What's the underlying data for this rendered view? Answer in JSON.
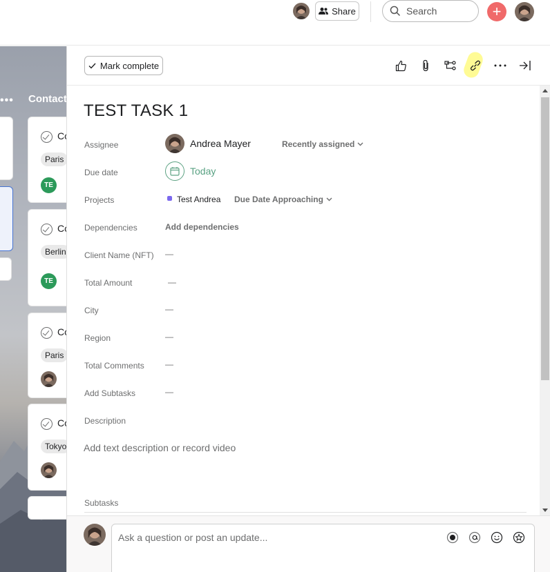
{
  "topbar": {
    "share_label": "Share",
    "search_placeholder": "Search",
    "create_label": "+"
  },
  "board": {
    "column_dots": "•••",
    "column_title": "Contacts",
    "cards": [
      {
        "title": "Co",
        "tag": "Paris",
        "assignee": "TE"
      },
      {
        "title": "Co",
        "tag": "Berlin",
        "assignee": "TE"
      },
      {
        "title": "Co",
        "tag": "Paris",
        "assignee": "avatar"
      },
      {
        "title": "Co",
        "tag": "Tokyo",
        "assignee": "avatar"
      }
    ]
  },
  "toolbar": {
    "mark_complete_label": "Mark complete",
    "icons": [
      "like-icon",
      "attachment-icon",
      "subtask-icon",
      "link-icon",
      "more-icon",
      "close-pane-icon"
    ]
  },
  "task": {
    "title": "TEST TASK 1",
    "fields": {
      "assignee_label": "Assignee",
      "assignee_name": "Andrea Mayer",
      "recently_assigned": "Recently assigned",
      "due_date_label": "Due date",
      "due_date_value": "Today",
      "projects_label": "Projects",
      "project_name": "Test Andrea",
      "project_status": "Due Date Approaching",
      "dependencies_label": "Dependencies",
      "dependencies_value": "Add dependencies",
      "client_name_label": "Client Name (NFT)",
      "client_name_value": "—",
      "total_amount_label": "Total Amount",
      "total_amount_value": "—",
      "city_label": "City",
      "city_value": "—",
      "region_label": "Region",
      "region_value": "—",
      "total_comments_label": "Total Comments",
      "total_comments_value": "—",
      "add_subtasks_label": "Add Subtasks",
      "add_subtasks_value": "—",
      "description_label": "Description",
      "description_placeholder": "Add text description or record video",
      "subtasks_label": "Subtasks"
    }
  },
  "comment": {
    "placeholder": "Ask a question or post an update..."
  },
  "colors": {
    "accent_red": "#f06a6a",
    "due_green": "#58a182",
    "project_purple": "#7b68ee",
    "te_green": "#2c9a5a",
    "highlight_yellow": "#fffb8a"
  }
}
